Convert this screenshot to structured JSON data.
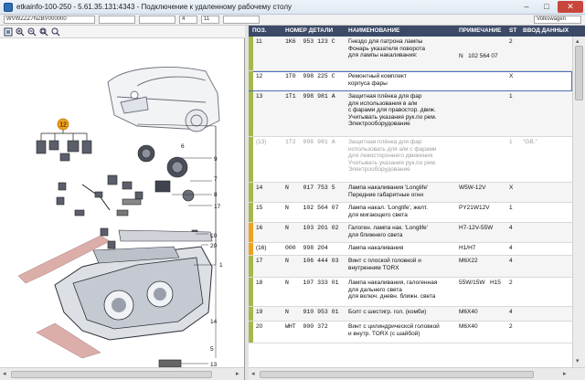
{
  "window": {
    "title": "etkainfo-100-250 - 5.61.35.131:4343 - Подключение к удаленному рабочему столу",
    "minimize": "–",
    "maximize": "□",
    "close": "✕"
  },
  "toolbar": {
    "field1": "WVWZZZ7NZBV000000",
    "field2": "4",
    "field3": "11",
    "field4": "Volkswagen"
  },
  "diagram": {
    "callout": "12",
    "labels": [
      "6",
      "9",
      "7",
      "8",
      "17",
      "10",
      "20",
      "1",
      "14",
      "5",
      "13"
    ]
  },
  "table": {
    "headers": [
      "ПОЗ.",
      "НОМЕР ДЕТАЛИ",
      "НАИМЕНОВАНИЕ",
      "ПРИМЕЧАНИЕ",
      "ST",
      "ВВОД ДАННЫХ"
    ],
    "rows": [
      {
        "pos": "11",
        "part": "1K6  953 123 C",
        "name": "Гнездо для патрона лампы\nФонарь указателя поворота\nдля лампы накаливания:",
        "note": "N   102 564 07",
        "st": "2",
        "data": ""
      },
      {
        "pos": "12",
        "part": "1T0  998 225 C",
        "name": "Ремонтный комплект\nкорпуса фары",
        "note": "",
        "st": "X",
        "data": ""
      },
      {
        "pos": "13",
        "part": "1T1  998 981 A",
        "name": "Защитная плёнка для фар\nдля использования в а/м\nс фарами для правостор. движ.\nУчитывать указания рук.по рем.\nЭлектрооборудование",
        "note": "",
        "st": "1",
        "data": ""
      },
      {
        "pos": "(13)",
        "part": "1T2  998 981 A",
        "name": "Защитная плёнка для фар\nиспользовать для а/м с фарами\nдля левостороннего движения\nУчитывать указания рук.по рем.\nЭлектрооборудование",
        "note": "",
        "st": "1",
        "data": "\"GB.\""
      },
      {
        "pos": "14",
        "part": "N    017 753 5",
        "name": "Лампа накаливания 'Longlife'\nПередние габаритные огни",
        "note": "W5W-12V",
        "st": "X",
        "data": ""
      },
      {
        "pos": "15",
        "part": "N    102 564 07",
        "name": "Лампа накал. 'Longlife', желт.\nдля мигающего света",
        "note": "PY21W12V",
        "st": "1",
        "data": ""
      },
      {
        "pos": "16",
        "part": "N    103 201 02",
        "name": "Галоген. лампа нак. 'Longlife'\nдля ближнего света",
        "note": "H7-12V-55W",
        "st": "4",
        "data": ""
      },
      {
        "pos": "(16)",
        "part": "000  998 204",
        "name": "Лампа накаливания",
        "note": "H1/H7",
        "st": "4",
        "data": ""
      },
      {
        "pos": "17",
        "part": "N    106 444 03",
        "name": "Винт с плоской головкой и\nвнутренним TORX",
        "note": "M6X22",
        "st": "4",
        "data": ""
      },
      {
        "pos": "18",
        "part": "N    107 333 01",
        "name": "Лампа накаливания, галогенная\nдля дальнего света\nдля включ. дневн. ближн. света",
        "note": "55W/15W   H15",
        "st": "2",
        "data": ""
      },
      {
        "pos": "19",
        "part": "N    910 953 01",
        "name": "Болт с шестигр. гол. (комби)",
        "note": "M6X40",
        "st": "4",
        "data": ""
      },
      {
        "pos": "20",
        "part": "WHT  000 372",
        "name": "Винт с цилиндрической головкой\nи внутр. TORX (с шайбой)",
        "note": "M6X40",
        "st": "2",
        "data": ""
      }
    ]
  },
  "colors": {
    "header_bg": "#3c4a68",
    "row_marker_green": "#a6b84a",
    "row_marker_orange": "#f0a21c",
    "callout": "#f2a21a"
  }
}
